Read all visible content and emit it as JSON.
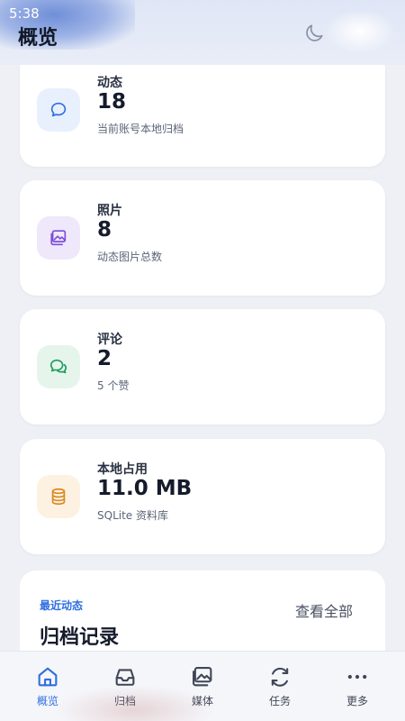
{
  "status_bar": {
    "time": "5:38"
  },
  "header": {
    "title": "概览",
    "theme_toggle_icon": "moon-icon"
  },
  "stats": [
    {
      "id": "posts",
      "label": "动态",
      "value": "18",
      "sub": "当前账号本地归档",
      "icon": "chat-bubble-icon",
      "icon_color": "#2f6ee0",
      "icon_bg": "#e8f0fd"
    },
    {
      "id": "photos",
      "label": "照片",
      "value": "8",
      "sub": "动态图片总数",
      "icon": "image-icon",
      "icon_color": "#7c4ddb",
      "icon_bg": "#efe8fb"
    },
    {
      "id": "comments",
      "label": "评论",
      "value": "2",
      "sub": "5 个赞",
      "icon": "chat-bubbles-icon",
      "icon_color": "#1f9d5c",
      "icon_bg": "#e6f5ec"
    },
    {
      "id": "storage",
      "label": "本地占用",
      "value": "11.0 MB",
      "sub": "SQLite 资料库",
      "icon": "database-icon",
      "icon_color": "#d98a1f",
      "icon_bg": "#fdf1e2"
    }
  ],
  "recent": {
    "kicker": "最近动态",
    "title": "归档记录",
    "view_all": "查看全部"
  },
  "bottom_nav": [
    {
      "label": "概览",
      "icon": "home-icon",
      "active": true
    },
    {
      "label": "归档",
      "icon": "inbox-icon",
      "active": false
    },
    {
      "label": "媒体",
      "icon": "image-icon",
      "active": false
    },
    {
      "label": "任务",
      "icon": "refresh-icon",
      "active": false
    },
    {
      "label": "更多",
      "icon": "more-icon",
      "active": false
    }
  ]
}
